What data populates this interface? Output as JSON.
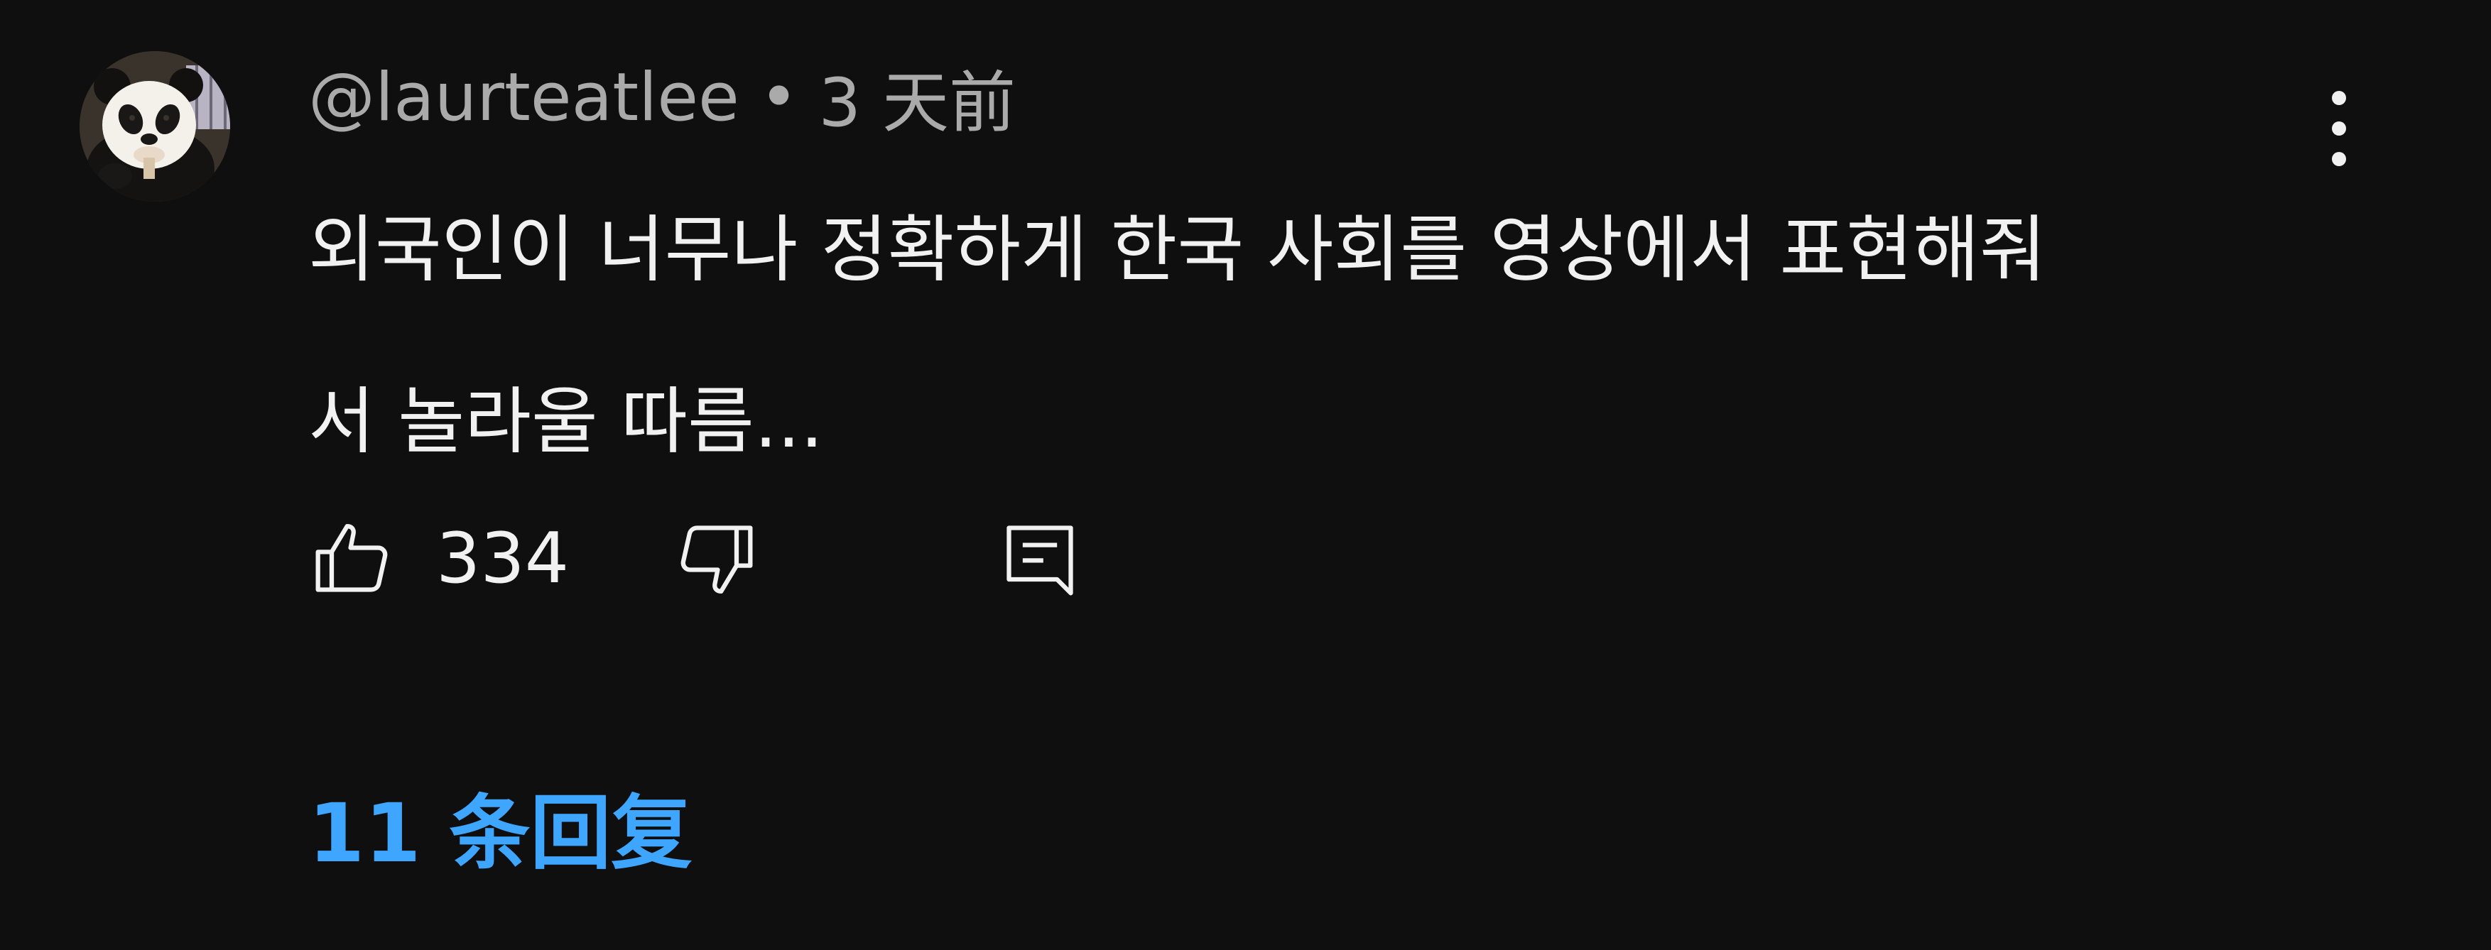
{
  "comment": {
    "author": "@laurteatlee",
    "separator": "•",
    "timestamp": "3 天前",
    "text_lines": [
      "외국인이 너무나 정확하게 한국 사회를 영상에서 표현해줘",
      "서 놀라울 따름..."
    ],
    "like_count": "334",
    "replies_label": "11 条回复",
    "avatar_icon": "panda-avatar",
    "colors": {
      "background": "#0f0f0f",
      "text": "#f1f1f1",
      "meta": "#aaaaaa",
      "link": "#3ea6ff"
    }
  }
}
